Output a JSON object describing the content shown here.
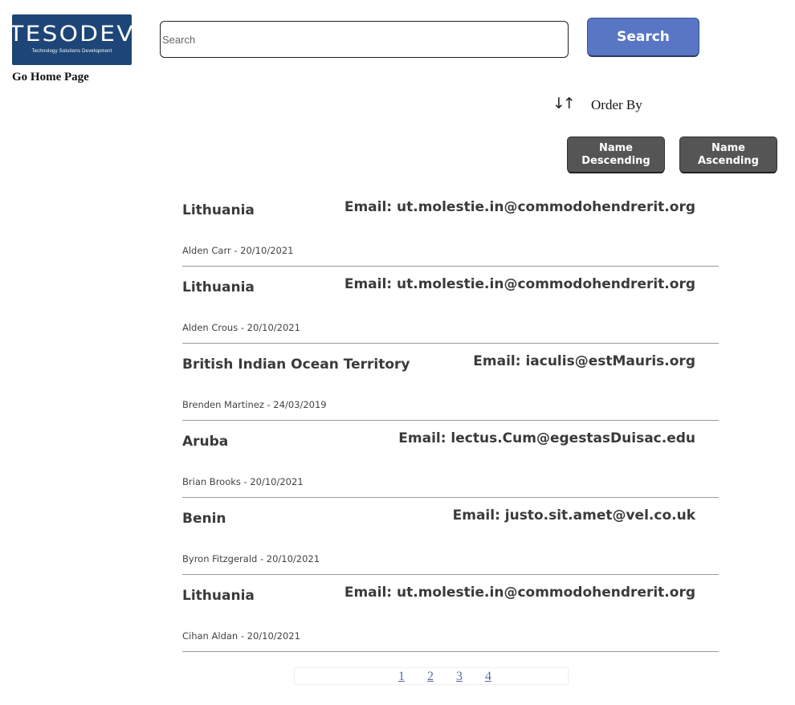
{
  "brand": {
    "logo_word": "TESODEV",
    "logo_tagline": "Technology Solutions Development",
    "home_link": "Go Home Page",
    "color": "#1d4577"
  },
  "search": {
    "placeholder": "Search",
    "value": "",
    "button_label": "Search",
    "button_color": "#5876c4"
  },
  "order": {
    "icon": "sort-arrows-icon",
    "icon_glyph": "↓↑",
    "label": "Order By",
    "buttons": [
      {
        "label": "Name Descending"
      },
      {
        "label": "Name Ascending"
      }
    ],
    "button_color": "#555555"
  },
  "results": [
    {
      "country": "Lithuania",
      "email": "Email: ut.molestie.in@commodohendrerit.org",
      "meta": "Alden Carr - 20/10/2021"
    },
    {
      "country": "Lithuania",
      "email": "Email: ut.molestie.in@commodohendrerit.org",
      "meta": "Alden Crous - 20/10/2021"
    },
    {
      "country": "British Indian Ocean Territory",
      "email": "Email: iaculis@estMauris.org",
      "meta": "Brenden Martinez - 24/03/2019"
    },
    {
      "country": "Aruba",
      "email": "Email: lectus.Cum@egestasDuisac.edu",
      "meta": "Brian Brooks - 20/10/2021"
    },
    {
      "country": "Benin",
      "email": "Email: justo.sit.amet@vel.co.uk",
      "meta": "Byron Fitzgerald - 20/10/2021"
    },
    {
      "country": "Lithuania",
      "email": "Email: ut.molestie.in@commodohendrerit.org",
      "meta": "Cihan Aldan - 20/10/2021"
    }
  ],
  "pagination": {
    "pages": [
      "1",
      "2",
      "3",
      "4"
    ]
  }
}
